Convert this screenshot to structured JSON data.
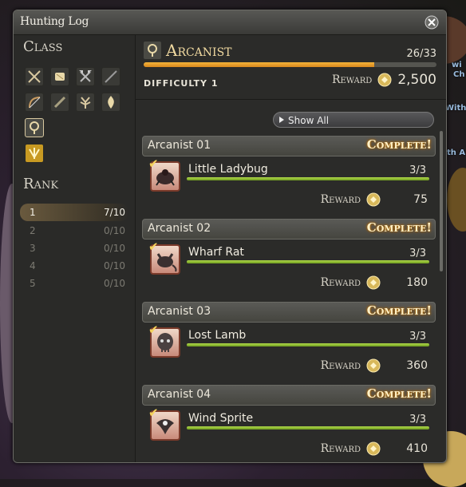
{
  "window": {
    "title": "Hunting Log"
  },
  "left_panel": {
    "class_heading": "Class",
    "class_icons": [
      "sword-icon",
      "gauntlet-icon",
      "axe-icon",
      "lance-icon",
      "bow-icon",
      "staff-icon",
      "tree-icon",
      "flame-icon",
      "arcanist-book-icon",
      "yellow-emblem-icon"
    ],
    "rank_heading": "Rank",
    "ranks": [
      {
        "rank": "1",
        "progress": "7/10",
        "active": true
      },
      {
        "rank": "2",
        "progress": "0/10",
        "active": false
      },
      {
        "rank": "3",
        "progress": "0/10",
        "active": false
      },
      {
        "rank": "4",
        "progress": "0/10",
        "active": false
      },
      {
        "rank": "5",
        "progress": "0/10",
        "active": false
      }
    ]
  },
  "job": {
    "name": "Arcanist",
    "progress_text": "26/33",
    "progress_fraction": 0.788,
    "difficulty": "DIFFICULTY 1",
    "reward_label": "Reward",
    "reward_value": "2,500"
  },
  "controls": {
    "show_all": "Show All"
  },
  "entries": [
    {
      "header": "Arcanist 01",
      "status": "Complete!",
      "mob": "Little Ladybug",
      "count": "3/3",
      "reward_label": "Reward",
      "reward": "75"
    },
    {
      "header": "Arcanist 02",
      "status": "Complete!",
      "mob": "Wharf Rat",
      "count": "3/3",
      "reward_label": "Reward",
      "reward": "180"
    },
    {
      "header": "Arcanist 03",
      "status": "Complete!",
      "mob": "Lost Lamb",
      "count": "3/3",
      "reward_label": "Reward",
      "reward": "360"
    },
    {
      "header": "Arcanist 04",
      "status": "Complete!",
      "mob": "Wind Sprite",
      "count": "3/3",
      "reward_label": "Reward",
      "reward": "410"
    }
  ],
  "background_text": [
    "wi",
    "Ch",
    "With",
    "th A"
  ]
}
